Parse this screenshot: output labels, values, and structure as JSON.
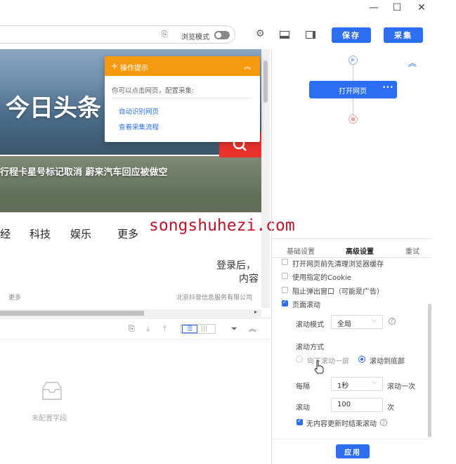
{
  "window": {
    "minimize": "—",
    "maximize": "☐",
    "close": "✕"
  },
  "toolbar": {
    "browse_mode": "浏览模式",
    "save": "保存",
    "collect": "采集"
  },
  "preview": {
    "logo_text": "今日头条",
    "headline": "行程卡星号标记取消   蔚来汽车回应被做空",
    "nav": [
      "经",
      "科技",
      "娱乐",
      "更多"
    ],
    "login_line1": "登录后，",
    "login_line2": "内容",
    "more": "更多",
    "footer_company": "北京抖音信息服务有限公司"
  },
  "popup": {
    "title": "操作提示",
    "body": "你可以点击网页，配置采集:",
    "links": [
      "自动识别网页",
      "查看采集流程"
    ]
  },
  "watermark": "songshuhezi.com",
  "fields": {
    "empty": "未配置字段"
  },
  "flow": {
    "node_label": "打开网页",
    "node_more": "•••"
  },
  "tabs": [
    "基础设置",
    "高级设置",
    "重试"
  ],
  "settings": {
    "clear_cache": "打开网页前先清理浏览器缓存",
    "use_cookie": "使用指定的Cookie",
    "block_popup": "阻止弹出窗口（可能是广告）",
    "page_scroll": "页面滚动",
    "scroll_mode_label": "滚动模式",
    "scroll_mode_value": "全局",
    "scroll_type_label": "滚动方式",
    "scroll_option_1": "向下滚动一屏",
    "scroll_option_2": "滚动到底部",
    "interval_label": "每隔",
    "interval_value": "1秒",
    "interval_suffix": "滚动一次",
    "scroll_count_label": "滚动",
    "scroll_count_value": "100",
    "scroll_count_suffix": "次",
    "stop_when_no_new": "无内容更新时结束滚动",
    "apply": "应用"
  },
  "colors": {
    "accent": "#2b6ff0",
    "popup_orange": "#f59a0e",
    "search_red": "#e8312c"
  }
}
